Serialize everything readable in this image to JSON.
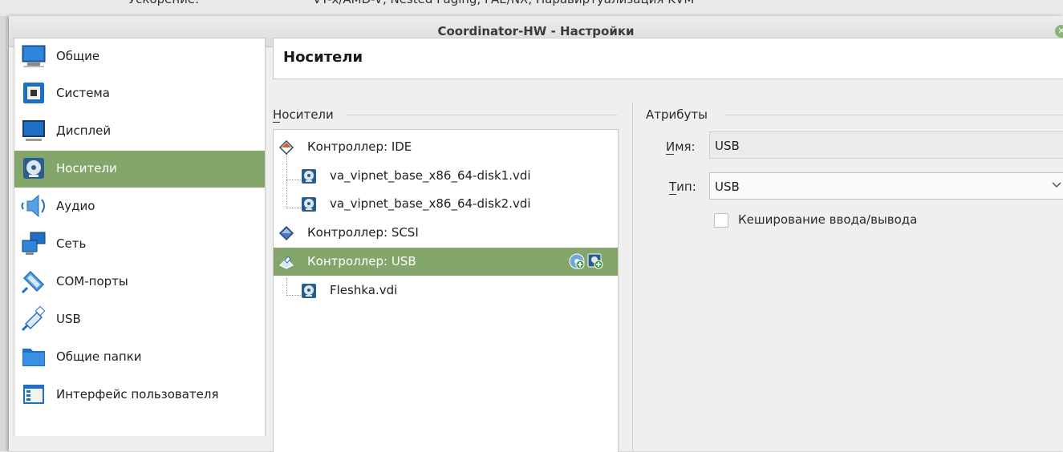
{
  "background": {
    "text_left": "Ускорение:",
    "text_right": "VT-x/AMD-V, Nested Paging, PAE/NX, Паравиртуализация KVM"
  },
  "window": {
    "title": "Coordinator-HW - Настройки"
  },
  "sidebar": {
    "items": [
      {
        "label": "Общие",
        "icon": "general-monitor-icon"
      },
      {
        "label": "Система",
        "icon": "system-chip-icon"
      },
      {
        "label": "Дисплей",
        "icon": "display-monitor-icon"
      },
      {
        "label": "Носители",
        "icon": "storage-disk-icon"
      },
      {
        "label": "Аудио",
        "icon": "audio-speaker-icon"
      },
      {
        "label": "Сеть",
        "icon": "network-icon"
      },
      {
        "label": "COM-порты",
        "icon": "serial-port-icon"
      },
      {
        "label": "USB",
        "icon": "usb-icon"
      },
      {
        "label": "Общие папки",
        "icon": "shared-folder-icon"
      },
      {
        "label": "Интерфейс пользователя",
        "icon": "user-interface-icon"
      }
    ],
    "selected": "Носители"
  },
  "page": {
    "title": "Носители"
  },
  "storage": {
    "group_label": "Носители",
    "tree": [
      {
        "label": "Контроллер: IDE",
        "type": "controller",
        "icon": "ide-controller-icon"
      },
      {
        "label": "va_vipnet_base_x86_64-disk1.vdi",
        "type": "disk",
        "icon": "hard-disk-icon"
      },
      {
        "label": "va_vipnet_base_x86_64-disk2.vdi",
        "type": "disk",
        "icon": "hard-disk-icon"
      },
      {
        "label": "Контроллер: SCSI",
        "type": "controller",
        "icon": "scsi-controller-icon"
      },
      {
        "label": "Контроллер: USB",
        "type": "controller",
        "icon": "usb-controller-icon",
        "selected": true
      },
      {
        "label": "Fleshka.vdi",
        "type": "disk",
        "icon": "hard-disk-icon"
      }
    ]
  },
  "attributes": {
    "group_label": "Атрибуты",
    "name_label": "Имя:",
    "name_value": "USB",
    "type_label": "Тип:",
    "type_value": "USB",
    "cache_label": "Кеширование ввода/вывода",
    "cache_checked": false
  },
  "colors": {
    "selection": "#84a66a",
    "icon_blue": "#1f6fc5"
  }
}
